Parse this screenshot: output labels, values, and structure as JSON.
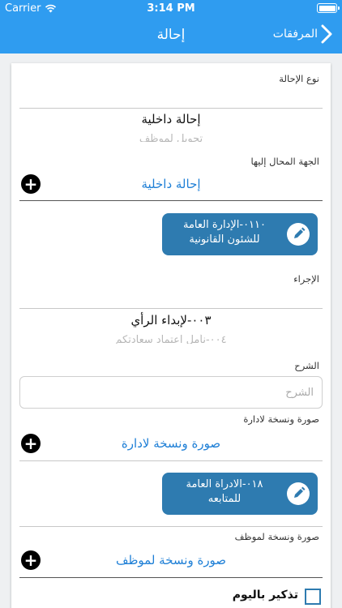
{
  "status_bar": {
    "carrier": "Carrier",
    "time": "3:14 PM"
  },
  "nav": {
    "title": "إحالة",
    "back_label": "المرفقات"
  },
  "form": {
    "referral_type": {
      "label": "نوع الإحالة",
      "selected": "إحالة داخلية",
      "next_option": "تحويل لموظف"
    },
    "referred_to": {
      "label": "الجهة المحال إليها",
      "action_label": "إحالة داخلية",
      "chips": [
        "٠١١٠-الإدارة العامة للشئون القانونية"
      ]
    },
    "procedure": {
      "label": "الإجراء",
      "selected": "٠٠٣-لإبداء الرأي",
      "next_option": "٠٠٤-نأمل اعتماد سعادتكم"
    },
    "explanation": {
      "label": "الشرح",
      "placeholder": "الشرح",
      "value": ""
    },
    "copy_to_department": {
      "label": "صورة ونسخة لادارة",
      "action_label": "صورة ونسخة لادارة",
      "chips": [
        "٠١٨-الادراة العامة للمتابعه"
      ]
    },
    "copy_to_employee": {
      "label": "صورة ونسخة لموظف",
      "action_label": "صورة ونسخة لموظف"
    },
    "remind_today": {
      "label": "تذكير باليوم",
      "checked": false
    }
  },
  "colors": {
    "primary": "#2f9cf0",
    "chip": "#2e7bb0",
    "link": "#1e7fd6"
  }
}
